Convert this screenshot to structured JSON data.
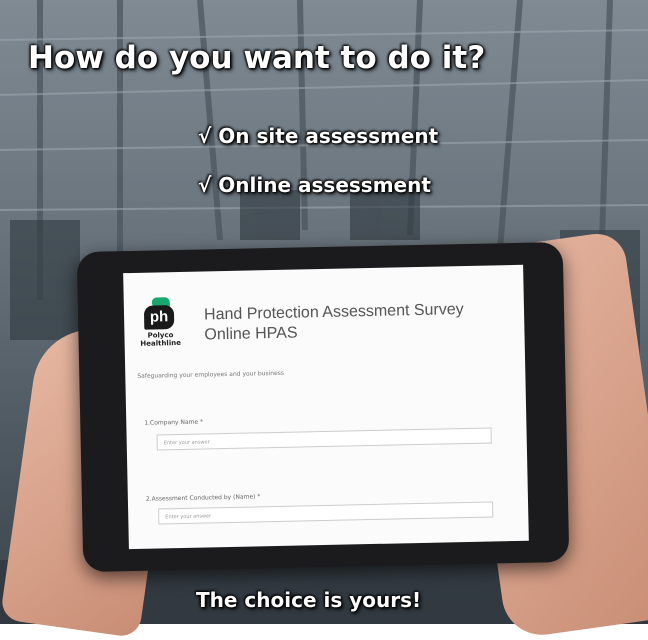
{
  "headline": {
    "title": "How do you want to do it?",
    "bullet_1": "√ On site assessment",
    "bullet_2": "√ Online assessment",
    "footer": "The choice is yours!"
  },
  "form": {
    "logo_mark": "ph",
    "logo_brand": "Polyco Healthline",
    "title_line_1": "Hand Protection Assessment Survey",
    "title_line_2": "Online HPAS",
    "tagline": "Safeguarding your employees and your business",
    "questions": [
      {
        "label": "1.Company Name *",
        "placeholder": "Enter your answer"
      },
      {
        "label": "2.Assessment Conducted by (Name) *",
        "placeholder": "Enter your answer"
      }
    ]
  },
  "colors": {
    "accent_green": "#18a870",
    "text_white": "#ffffff"
  }
}
